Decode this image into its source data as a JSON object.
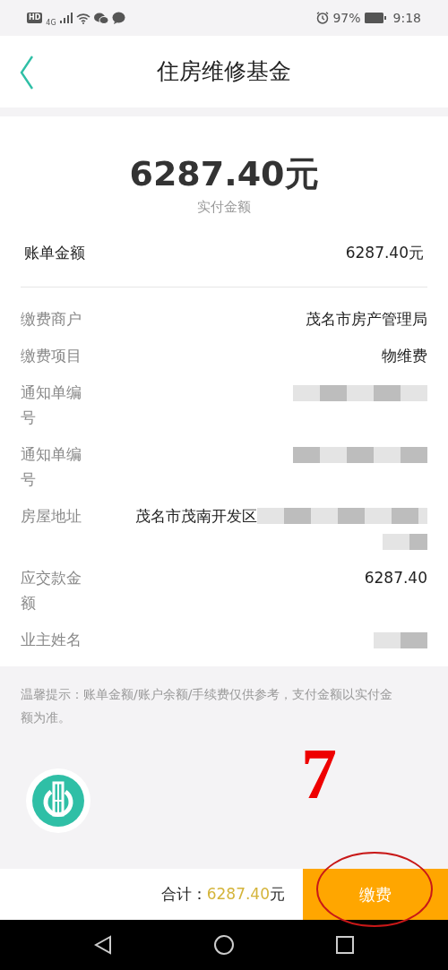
{
  "status_bar": {
    "network_badges": [
      "HD",
      "4G"
    ],
    "battery": "97%",
    "time": "9:18"
  },
  "header": {
    "title": "住房维修基金"
  },
  "summary": {
    "amount": "6287.40元",
    "caption": "实付金额"
  },
  "bill": {
    "label": "账单金额",
    "value": "6287.40元"
  },
  "details": [
    {
      "label": "缴费商户",
      "kind": "text",
      "value": "茂名市房产管理局"
    },
    {
      "label": "缴费项目",
      "kind": "text",
      "value": "物维费"
    },
    {
      "label": "通知单编号",
      "kind": "redacted"
    },
    {
      "label": "通知单编号",
      "kind": "redacted"
    },
    {
      "label": "房屋地址",
      "kind": "partly_redacted",
      "value": "茂名市茂南开发区"
    },
    {
      "label": "应交款金额",
      "kind": "text",
      "value": "6287.40"
    },
    {
      "label": "业主姓名",
      "kind": "redacted_short"
    }
  ],
  "tip": "温馨提示：账单金额/账户余额/手续费仅供参考，支付金额以实付金额为准。",
  "annotation": {
    "text": "7"
  },
  "footer": {
    "total_label": "合计：",
    "total_value": "6287.40",
    "total_unit": "元",
    "pay_button": "缴费"
  }
}
